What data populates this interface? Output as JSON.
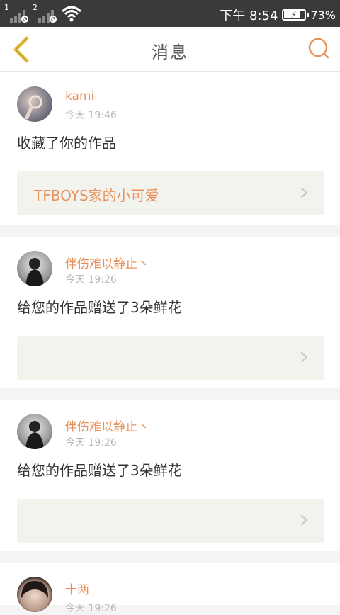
{
  "status_bar": {
    "sim1": "1",
    "sim2": "2",
    "time": "下午 8:54",
    "battery": "73%",
    "battery_level": 0.73
  },
  "header": {
    "title": "消息",
    "back_icon": "chevron-left-icon",
    "search_icon": "search-icon"
  },
  "messages": [
    {
      "user": "kami",
      "time": "今天 19:46",
      "action": "收藏了你的作品",
      "work_title": "TFBOYS家的小可爱"
    },
    {
      "user": "伴伤难以静止丶",
      "time": "今天 19:26",
      "action": "给您的作品赠送了3朵鲜花",
      "work_title": ""
    },
    {
      "user": "伴伤难以静止丶",
      "time": "今天 19:26",
      "action": "给您的作品赠送了3朵鲜花",
      "work_title": ""
    },
    {
      "user": "十两",
      "time": "今天 19:26",
      "action": "",
      "work_title": ""
    }
  ],
  "colors": {
    "accent": "#e8915a",
    "back_icon": "#e6c13a",
    "card_box": "#f3f3ee"
  }
}
